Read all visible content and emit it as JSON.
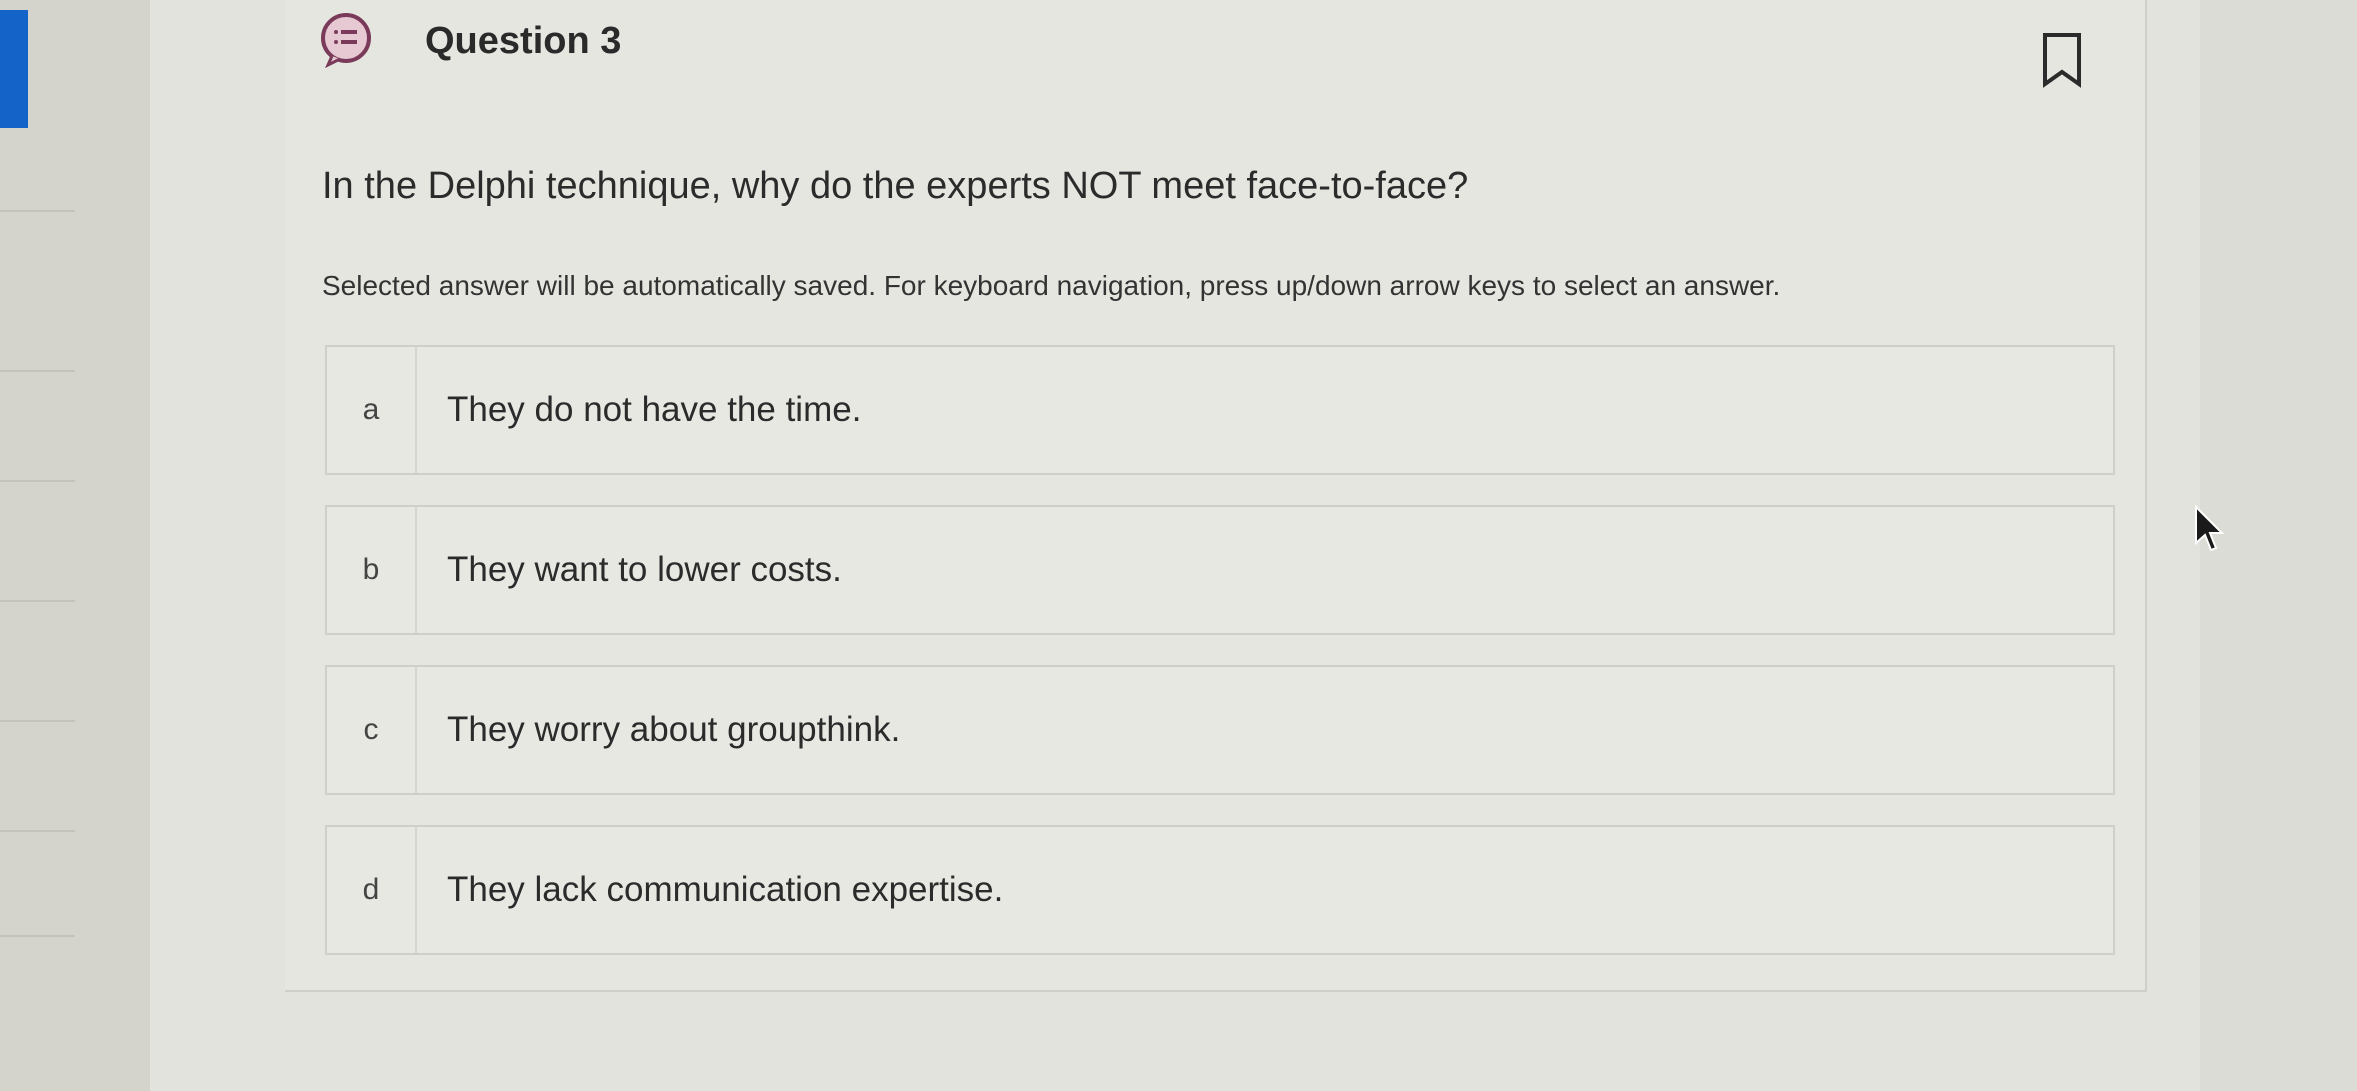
{
  "question": {
    "title": "Question 3",
    "text": "In the Delphi technique, why do the experts NOT meet face-to-face?",
    "instructions": "Selected answer will be automatically saved. For keyboard navigation, press up/down arrow keys to select an answer."
  },
  "answers": [
    {
      "letter": "a",
      "text": "They do not have the time."
    },
    {
      "letter": "b",
      "text": "They want to lower costs."
    },
    {
      "letter": "c",
      "text": "They worry about groupthink."
    },
    {
      "letter": "d",
      "text": "They lack communication expertise."
    }
  ],
  "icons": {
    "question_icon": "question-list-icon",
    "bookmark_icon": "bookmark-icon",
    "cursor_icon": "mouse-pointer-icon"
  },
  "colors": {
    "accent": "#1463c9",
    "icon_color": "#7a3a5a",
    "icon_bg": "#e7c9d3"
  }
}
